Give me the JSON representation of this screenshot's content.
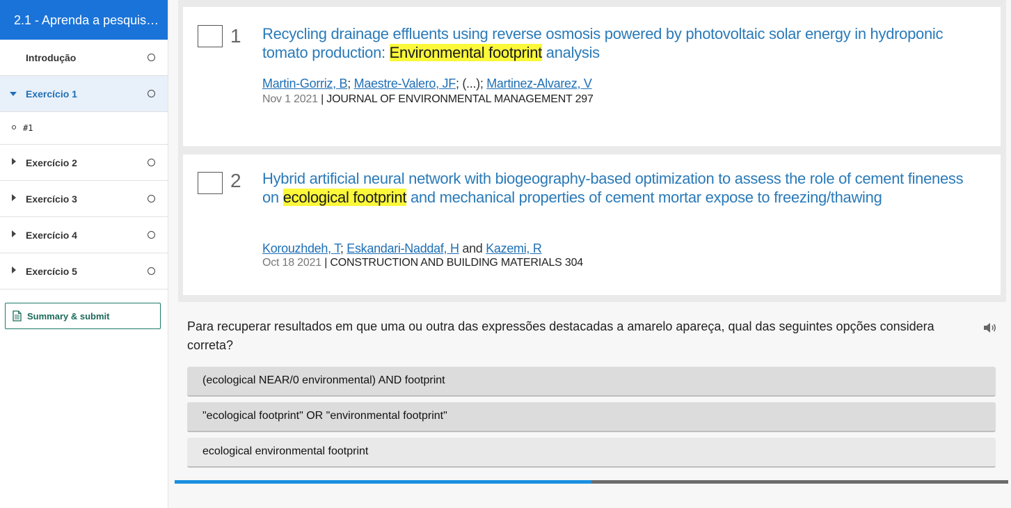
{
  "sidebar": {
    "title": "2.1 - Aprenda a pesquis…",
    "items": [
      {
        "label": "Introdução"
      },
      {
        "label": "Exercício 1"
      },
      {
        "label": "#1"
      },
      {
        "label": "Exercício 2"
      },
      {
        "label": "Exercício 3"
      },
      {
        "label": "Exercício 4"
      },
      {
        "label": "Exercício 5"
      }
    ],
    "summary_label": "Summary & submit"
  },
  "results": [
    {
      "number": "1",
      "title_before": "Recycling drainage effluents using reverse osmosis powered by photovoltaic solar energy in hydroponic tomato production: ",
      "title_highlight": "Environmental footprint",
      "title_after": " analysis",
      "authors": [
        "Martin-Gorriz, B",
        "Maestre-Valero, JF",
        "Martinez-Alvarez, V"
      ],
      "author_sep_1": "; ",
      "author_sep_2": "; (...); ",
      "date": "Nov 1 2021",
      "source": "| JOURNAL OF ENVIRONMENTAL MANAGEMENT 297"
    },
    {
      "number": "2",
      "title_before": "Hybrid artificial neural network with biogeography-based optimization to assess the role of cement fineness on ",
      "title_highlight": "ecological footprint",
      "title_after": " and mechanical properties of cement mortar expose to freezing/thawing",
      "authors": [
        "Korouzhdeh, T",
        "Eskandari-Naddaf, H",
        "Kazemi, R"
      ],
      "author_sep_1": "; ",
      "author_sep_2": " and ",
      "date": "Oct 18 2021",
      "source": "| CONSTRUCTION AND BUILDING MATERIALS 304"
    }
  ],
  "question": "Para recuperar resultados em que uma ou outra das expressões destacadas a amarelo apareça, qual das seguintes opções considera correta?",
  "options": [
    "(ecological NEAR/0 environmental) AND footprint",
    "\"ecological footprint\" OR \"environmental footprint\"",
    "ecological environmental footprint"
  ],
  "progress": {
    "fraction": 0.5
  },
  "colors": {
    "accent": "#1a73d9",
    "link": "#1f6fb5",
    "highlight": "#fbf83a",
    "progress_fill": "#1a8fe0",
    "summary": "#1b7a67"
  }
}
